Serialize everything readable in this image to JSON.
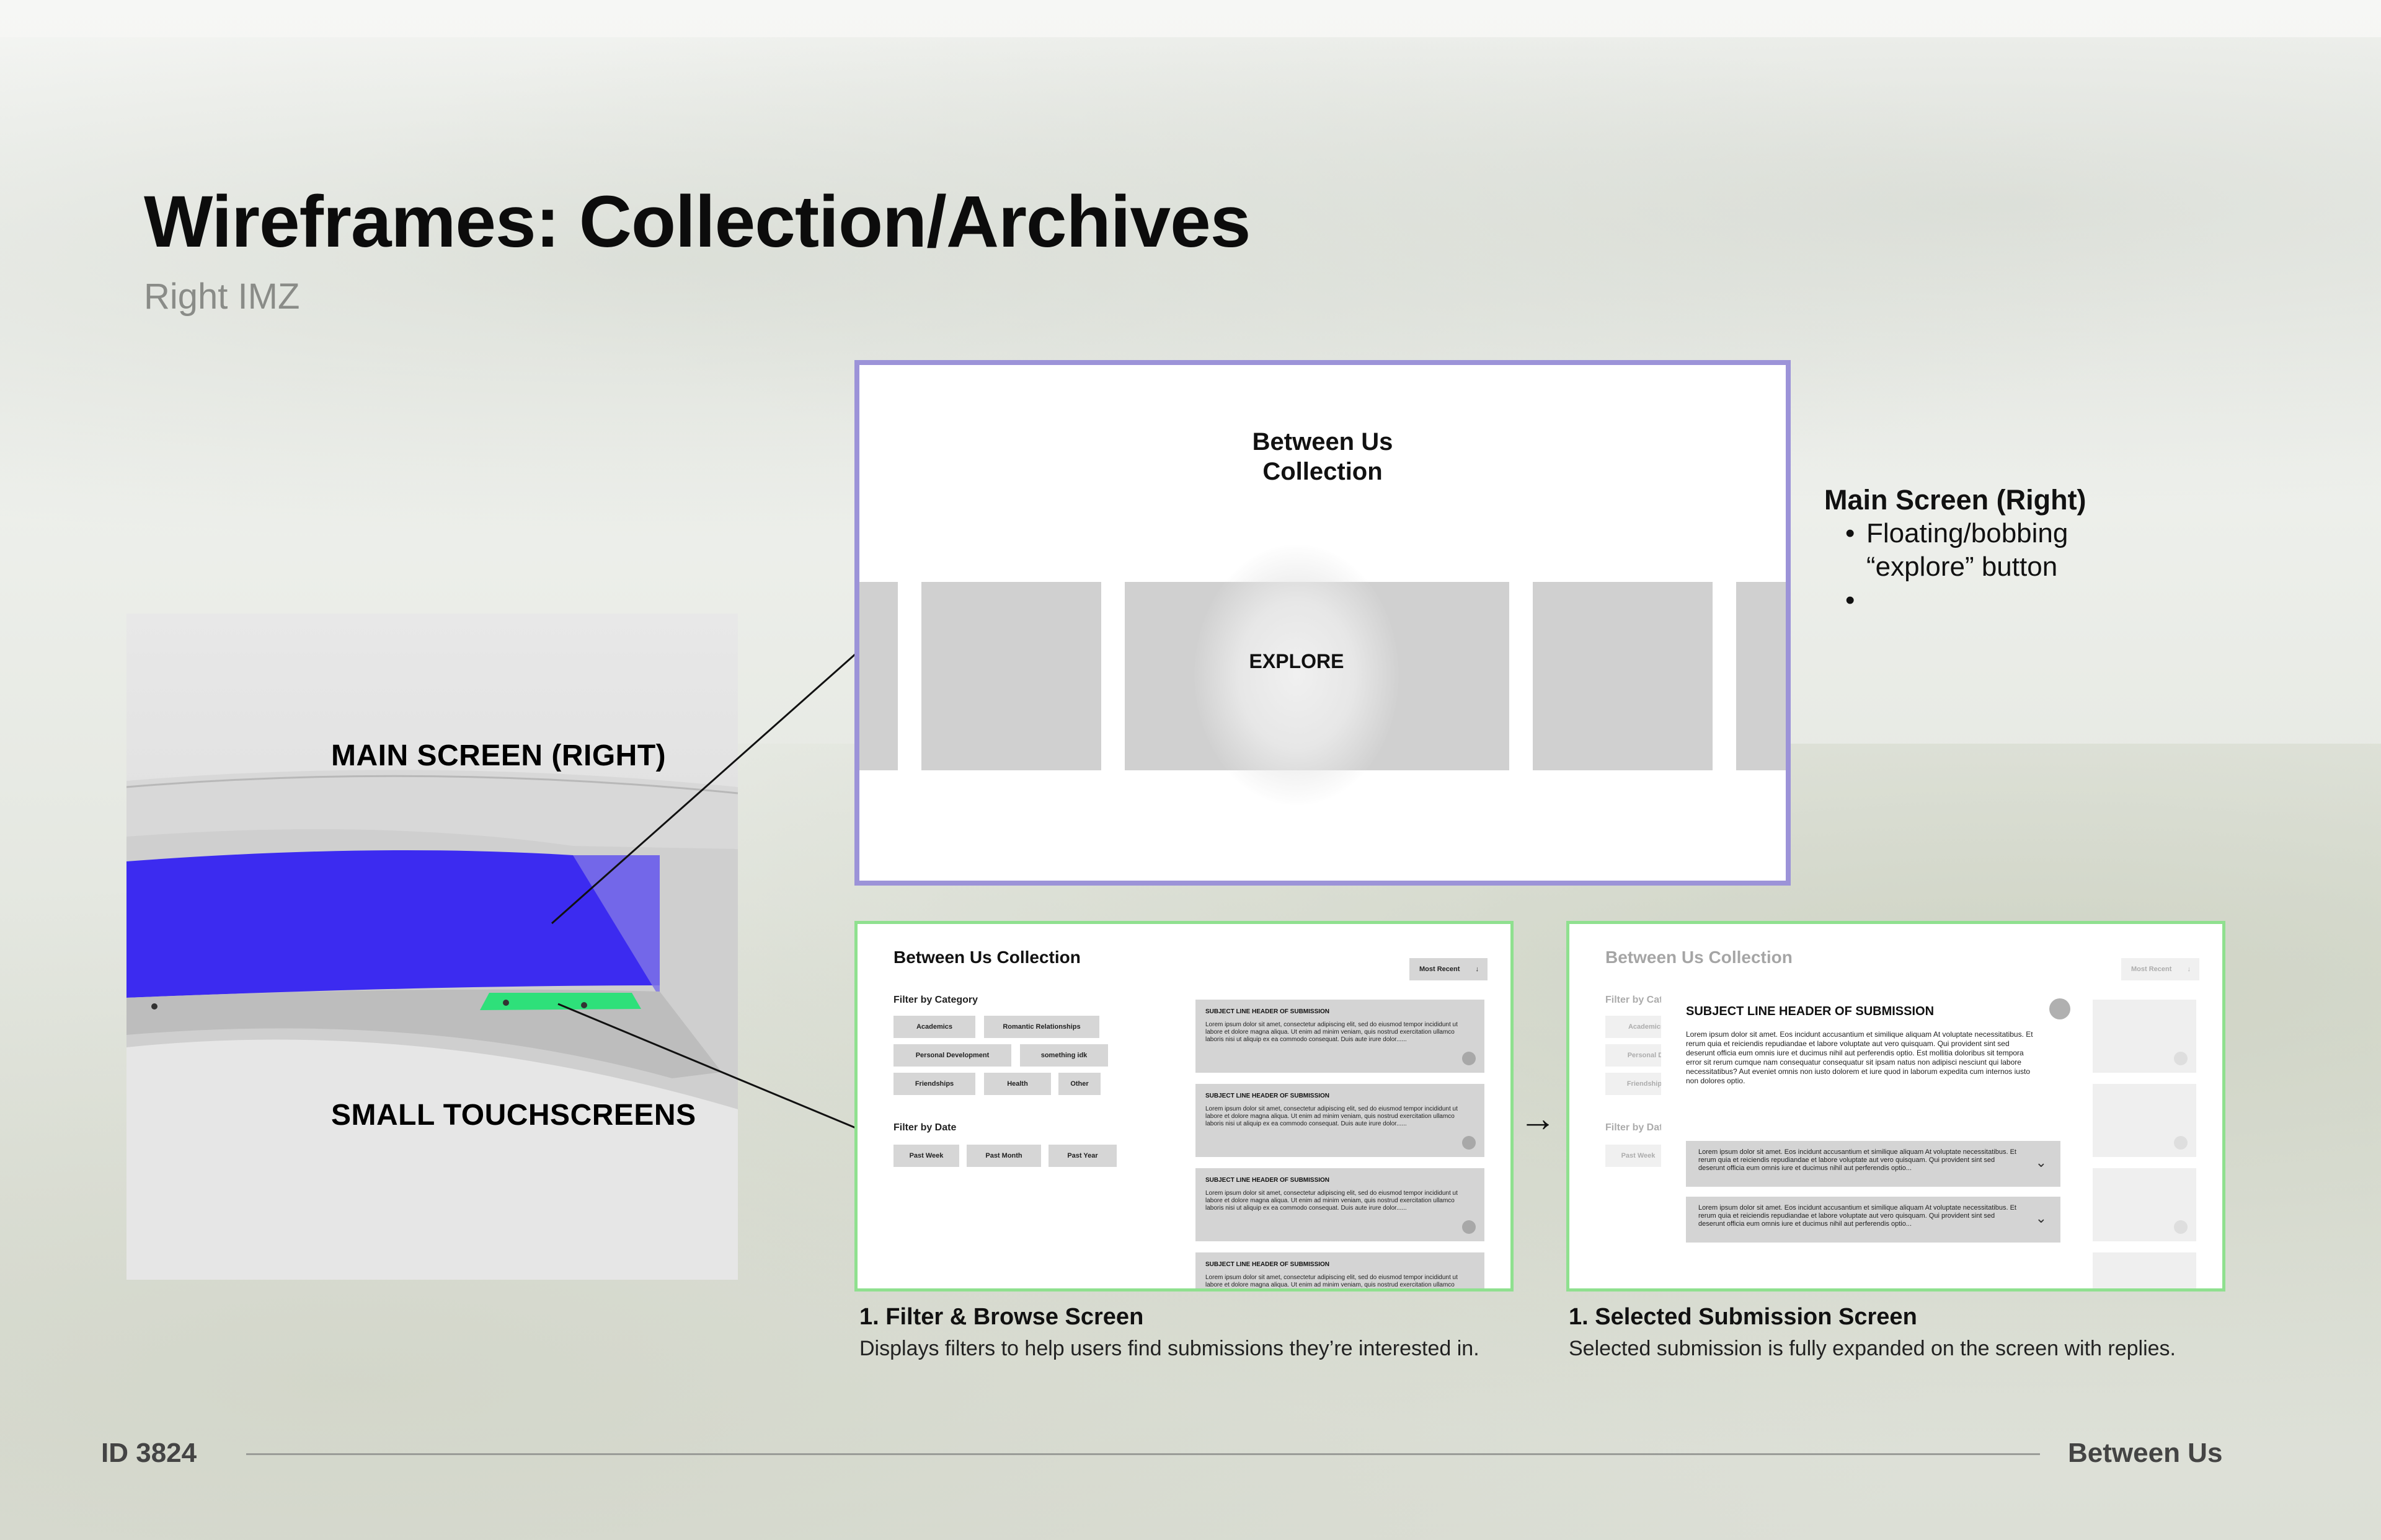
{
  "header": {
    "title": "Wireframes: Collection/Archives",
    "subtitle": "Right IMZ"
  },
  "render": {
    "main_label": "MAIN SCREEN (RIGHT)",
    "touch_label": "SMALL TOUCHSCREENS",
    "screen_color": "#3c2bf0",
    "touch_color": "#2ee07a"
  },
  "main_screen": {
    "title_line1": "Between Us",
    "title_line2": "Collection",
    "explore_label": "EXPLORE",
    "border_color": "#9c93d8"
  },
  "side_note": {
    "heading": "Main Screen (Right)",
    "bullets": [
      "Floating/bobbing “explore” button",
      ""
    ]
  },
  "browse_screen": {
    "title": "Between Us Collection",
    "sort_label": "Most Recent",
    "sort_arrow": "↓",
    "filter_category_label": "Filter by Category",
    "categories": [
      "Academics",
      "Romantic Relationships",
      "Personal Development",
      "something idk",
      "Friendships",
      "Health",
      "Other"
    ],
    "filter_date_label": "Filter by Date",
    "dates": [
      "Past Week",
      "Past Month",
      "Past Year"
    ],
    "cards": [
      {
        "header": "SUBJECT LINE HEADER OF SUBMISSION",
        "body": "Lorem ipsum dolor sit amet, consectetur adipiscing elit, sed do eiusmod tempor incididunt ut labore et dolore magna aliqua. Ut enim ad minim veniam, quis nostrud exercitation ullamco laboris nisi ut aliquip ex ea commodo consequat. Duis aute irure dolor......"
      },
      {
        "header": "SUBJECT LINE HEADER OF SUBMISSION",
        "body": "Lorem ipsum dolor sit amet, consectetur adipiscing elit, sed do eiusmod tempor incididunt ut labore et dolore magna aliqua. Ut enim ad minim veniam, quis nostrud exercitation ullamco laboris nisi ut aliquip ex ea commodo consequat. Duis aute irure dolor......"
      },
      {
        "header": "SUBJECT LINE HEADER OF SUBMISSION",
        "body": "Lorem ipsum dolor sit amet, consectetur adipiscing elit, sed do eiusmod tempor incididunt ut labore et dolore magna aliqua. Ut enim ad minim veniam, quis nostrud exercitation ullamco laboris nisi ut aliquip ex ea commodo consequat. Duis aute irure dolor......"
      },
      {
        "header": "SUBJECT LINE HEADER OF SUBMISSION",
        "body": "Lorem ipsum dolor sit amet, consectetur adipiscing elit, sed do eiusmod tempor incididunt ut labore et dolore magna aliqua. Ut enim ad minim veniam, quis nostrud exercitation ullamco laboris nisi ut aliquip ex ea commodo consequat."
      }
    ],
    "caption_title": "1. Filter & Browse Screen",
    "caption_desc": "Displays filters to help users find submissions they’re interested in."
  },
  "selected_screen": {
    "modal_header": "SUBJECT LINE HEADER OF SUBMISSION",
    "modal_body": "Lorem ipsum dolor sit amet. Eos incidunt accusantium et similique aliquam At voluptate necessitatibus. Et rerum quia et reiciendis repudiandae et labore voluptate aut vero quisquam. Qui provident sint sed deserunt officia eum omnis iure et ducimus nihil aut perferendis optio. Est mollitia doloribus sit tempora error sit rerum cumque nam consequatur consequatur sit ipsam natus non adipisci nesciunt qui labore necessitatibus? Aut eveniet omnis non iusto dolorem et iure quod in laborum expedita cum internos iusto non dolores optio.",
    "replies": [
      "Lorem ipsum dolor sit amet. Eos incidunt accusantium et similique aliquam At voluptate necessitatibus. Et rerum quia et reiciendis repudiandae et labore voluptate aut vero quisquam. Qui provident sint sed deserunt officia eum omnis iure et ducimus nihil aut perferendis optio...",
      "Lorem ipsum dolor sit amet. Eos incidunt accusantium et similique aliquam At voluptate necessitatibus. Et rerum quia et reiciendis repudiandae et labore voluptate aut vero quisquam. Qui provident sint sed deserunt officia eum omnis iure et ducimus nihil aut perferendis optio..."
    ],
    "caption_title": "1. Selected Submission Screen",
    "caption_desc": "Selected submission is fully expanded on the screen with replies."
  },
  "flow_arrow": "→",
  "footer": {
    "id": "ID 3824",
    "project": "Between Us"
  }
}
